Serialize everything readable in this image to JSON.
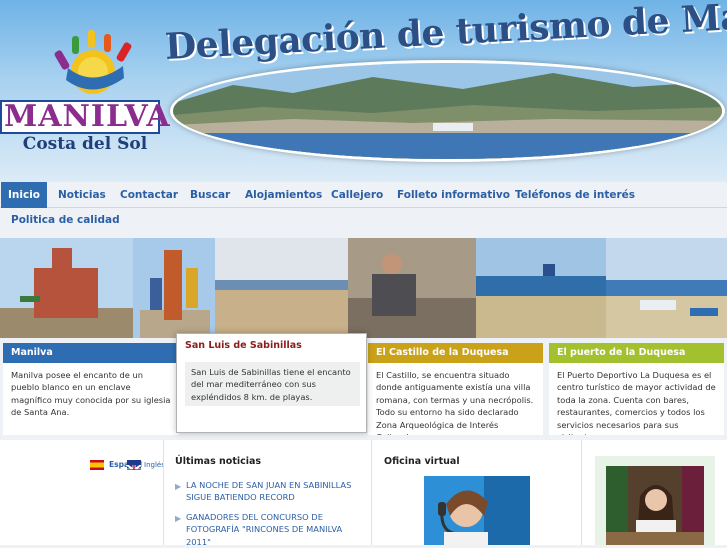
{
  "header": {
    "logo_name": "MANILVA",
    "logo_sub": "Costa del Sol",
    "title": "Delegación de turismo de Manilva"
  },
  "nav": {
    "items": [
      {
        "label": "Inicio",
        "active": true
      },
      {
        "label": "Noticias"
      },
      {
        "label": "Contactar"
      },
      {
        "label": "Buscar"
      },
      {
        "label": "Alojamientos"
      },
      {
        "label": "Callejero"
      },
      {
        "label": "Folleto informativo"
      },
      {
        "label": "Teléfonos de interés"
      }
    ],
    "sub_item": "Politica de calidad"
  },
  "features": [
    {
      "title": "Manilva",
      "text": "Manilva posee el encanto de un pueblo blanco en un enclave magnífico muy conocida por su iglesia de Santa Ana.",
      "color": "#2f6db3"
    },
    {
      "title": "San Luis de Sabinillas",
      "text": "San Luis de Sabinillas tiene el encanto del mar mediterráneo con sus expléndidos 8 km. de playas.",
      "color": "#8b1c1c"
    },
    {
      "title": "El Castillo de la Duquesa",
      "text": "El Castillo, se encuentra situado donde antiguamente existía una villa romana, con termas y una necrópolis. Todo su entorno ha sido declarado Zona Arqueológica de Interés Cultural.",
      "color": "#c9a21a"
    },
    {
      "title": "El puerto de la Duquesa",
      "text": "El Puerto Deportivo La Duquesa es el centro turístico de mayor actividad de toda la zona. Cuenta con bares, restaurantes, comercios y todos los servicios necesarios para sus visitantes.",
      "color": "#a3c12e"
    }
  ],
  "languages": {
    "es": "Español",
    "en": "Inglés"
  },
  "news": {
    "title": "Últimas noticias",
    "items": [
      "LA NOCHE DE SAN JUAN EN SABINILLAS SIGUE BATIENDO RECORD",
      "GANADORES DEL CONCURSO DE FOTOGRAFÍA \"RINCONES DE MANILVA 2011\""
    ]
  },
  "office": {
    "title": "Oficina virtual"
  }
}
